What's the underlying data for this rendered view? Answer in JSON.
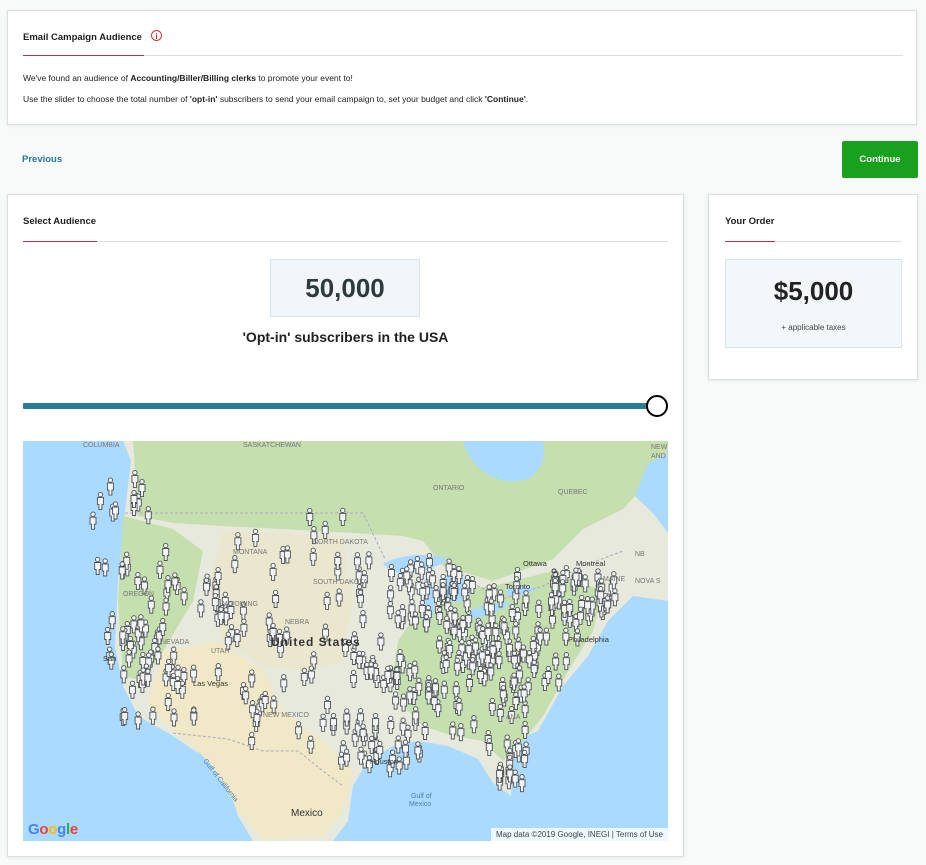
{
  "header": {
    "title": "Email Campaign Audience",
    "info_icon": "info-icon",
    "line1_prefix": "We've found an audience of ",
    "line1_bold": "Accounting/Biller/Billing clerks",
    "line1_suffix": " to promote your event to!",
    "line2_prefix": "Use the slider to choose the total number of ",
    "line2_bold1": "'opt-in'",
    "line2_mid": " subscribers to send your email campaign to, set your budget and click ",
    "line2_bold2": "'Continue'",
    "line2_suffix": "."
  },
  "nav": {
    "previous_label": "Previous",
    "continue_label": "Continue"
  },
  "audience": {
    "title": "Select Audience",
    "count": "50,000",
    "caption": "'Opt-in' subscribers in the USA",
    "slider_fraction": 1.0
  },
  "map": {
    "labels": {
      "columbia": "COLUMBIA",
      "saskatchewan": "SASKATCHEWAN",
      "ontario": "ONTARIO",
      "quebec": "QUEBEC",
      "ottawa": "Ottawa",
      "montreal": "Montreal",
      "nb": "NB",
      "nova": "NOVA S",
      "newf": "NEW",
      "and": "AND",
      "north_dakota": "NORTH DAKOTA",
      "montana": "MONTANA",
      "south_dakota": "SOUTH DAKOTA",
      "oregon": "OREGON",
      "wyoming": "WYOMING",
      "nebraska": "NEBRA",
      "nevada": "NEVADA",
      "utah": "UTAH",
      "united_states": "United States",
      "new_mexico": "NEW MEXICO",
      "toronto": "Toronto",
      "philadelphia": "Philadelphia",
      "san": "San",
      "las_vegas": "Las Vegas",
      "houston": "Houston",
      "gulf_california": "Gulf of California",
      "gulf_mexico_1": "Gulf of",
      "gulf_mexico_2": "Mexico",
      "mexico": "Mexico",
      "maine": "MAINE",
      "ana": "ANA"
    },
    "google": "Google",
    "attribution": "Map data ©2019 Google, INEGI",
    "terms": "Terms of Use",
    "colors": {
      "water": "#aadaff",
      "land": "#e6e9dc",
      "forest": "#c5dfae",
      "desert": "#f1e8c8",
      "pin": "#4d5256"
    }
  },
  "order": {
    "title": "Your Order",
    "price": "$5,000",
    "taxes": "+ applicable taxes"
  }
}
